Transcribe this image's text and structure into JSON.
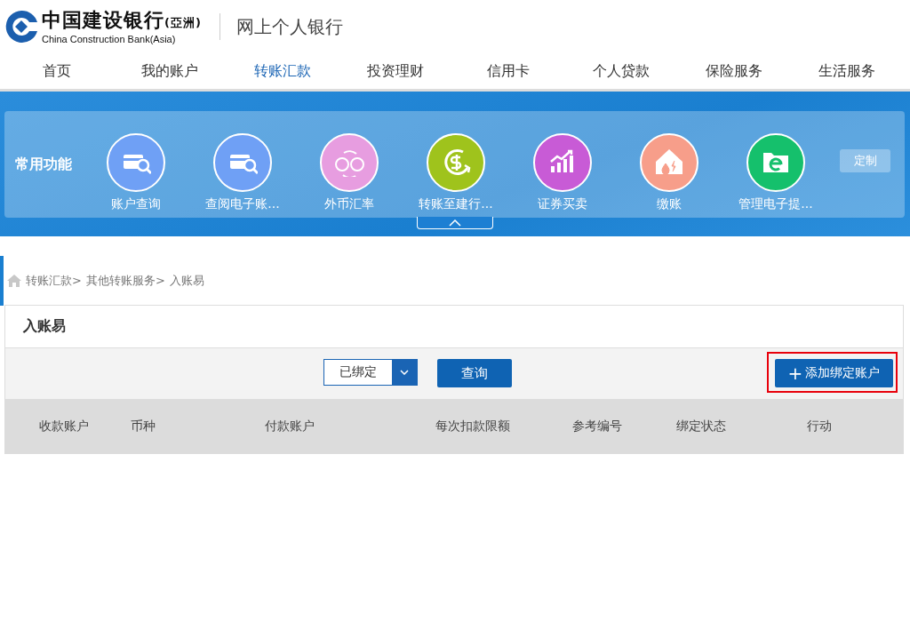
{
  "header": {
    "bank_name": "中国建设银行",
    "bank_region": "(亞洲)",
    "bank_name_en": "China Construction Bank(Asia)",
    "site_title": "网上个人银行"
  },
  "nav": [
    {
      "label": "首页",
      "selected": false
    },
    {
      "label": "我的账户",
      "selected": false
    },
    {
      "label": "转账汇款",
      "selected": true
    },
    {
      "label": "投资理财",
      "selected": false
    },
    {
      "label": "信用卡",
      "selected": false
    },
    {
      "label": "个人贷款",
      "selected": false
    },
    {
      "label": "保险服务",
      "selected": false
    },
    {
      "label": "生活服务",
      "selected": false
    }
  ],
  "shortcuts": {
    "title": "常用功能",
    "customize_button": "定制",
    "items": [
      {
        "label": "账户查询",
        "kind": "card-search",
        "color": "#6fa0f5"
      },
      {
        "label": "查阅电子账...",
        "kind": "card-search",
        "color": "#6fa0f5"
      },
      {
        "label": "外币汇率",
        "kind": "exchange",
        "color": "#e79de0"
      },
      {
        "label": "转账至建行...",
        "kind": "dollar",
        "color": "#9fc31c"
      },
      {
        "label": "证券买卖",
        "kind": "chart",
        "color": "#c85bd6"
      },
      {
        "label": "缴账",
        "kind": "house",
        "color": "#f79e8a"
      },
      {
        "label": "管理电子提...",
        "kind": "folder",
        "color": "#15c06c"
      }
    ],
    "expanded": true
  },
  "breadcrumb": [
    "转账汇款>",
    "其他转账服务>",
    "入账易"
  ],
  "panel": {
    "title": "入账易",
    "filter": {
      "value": "已绑定"
    },
    "query_button": "查询",
    "add_button": {
      "icon": "+",
      "label": "添加绑定账户",
      "highlighted": true
    },
    "table": {
      "columns": [
        "收款账户",
        "币种",
        "付款账户",
        "每次扣款限额",
        "参考编号",
        "绑定状态",
        "行动"
      ]
    }
  }
}
